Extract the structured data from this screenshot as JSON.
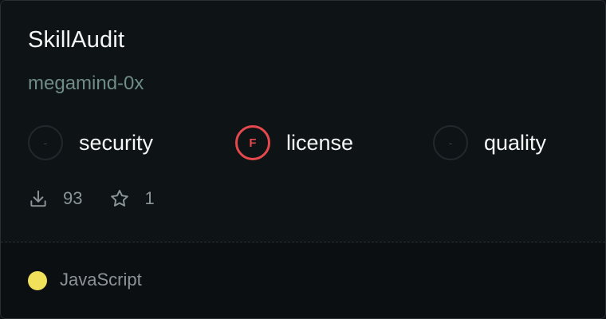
{
  "card": {
    "title": "SkillAudit",
    "owner": "megamind-0x"
  },
  "metrics": [
    {
      "label": "security",
      "grade": "-",
      "status": "none"
    },
    {
      "label": "license",
      "grade": "F",
      "status": "fail"
    },
    {
      "label": "quality",
      "grade": "-",
      "status": "none"
    }
  ],
  "stats": {
    "downloads": "93",
    "downloads_icon": "download-icon",
    "stars": "1",
    "stars_icon": "star-icon"
  },
  "footer": {
    "language": "JavaScript",
    "language_color": "#f1e05a"
  },
  "colors": {
    "fail": "#e5484d",
    "owner_text": "#6f8c86"
  }
}
